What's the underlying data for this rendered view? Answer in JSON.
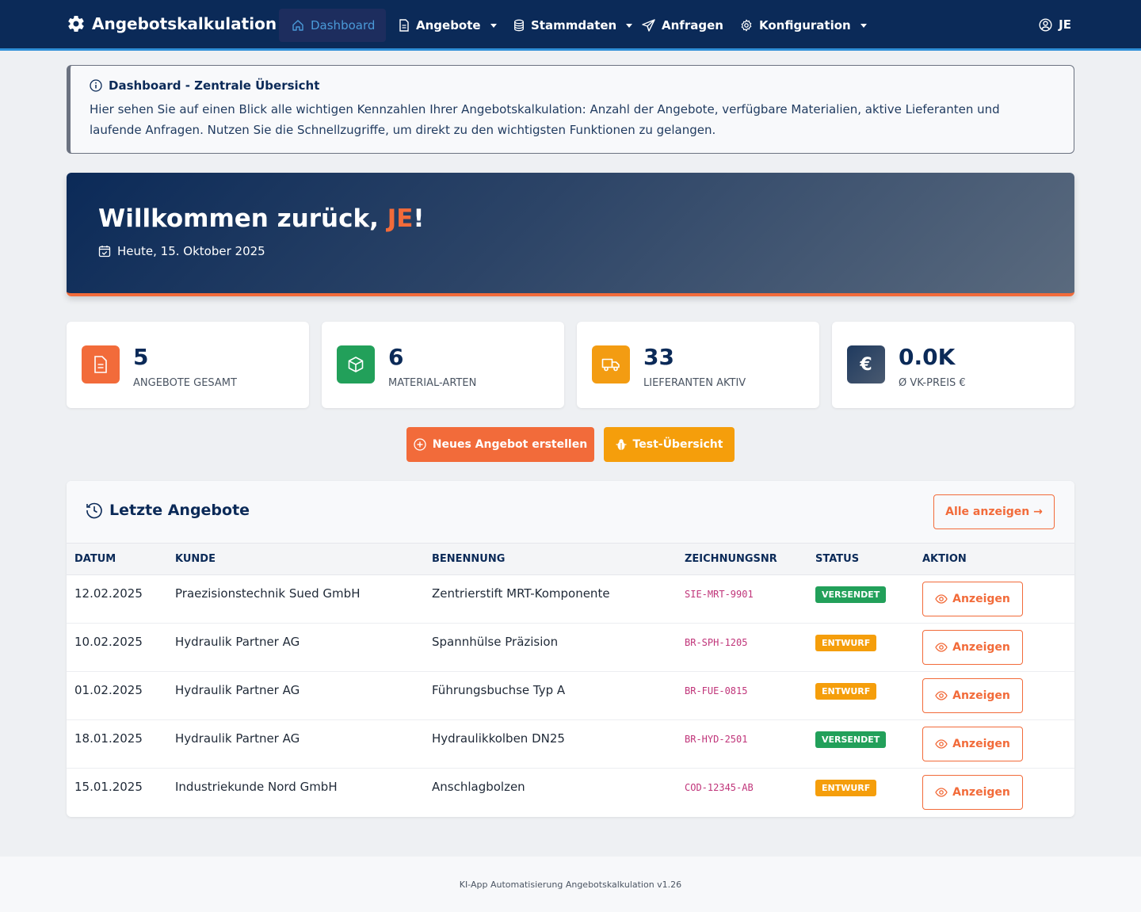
{
  "navbar": {
    "brand": "Angebotskalkulation",
    "items": [
      {
        "label": "Dashboard"
      },
      {
        "label": "Angebote"
      },
      {
        "label": "Stammdaten"
      },
      {
        "label": "Anfragen"
      },
      {
        "label": "Konfiguration"
      }
    ],
    "user": "JE"
  },
  "info": {
    "title": "Dashboard - Zentrale Übersicht",
    "text": "Hier sehen Sie auf einen Blick alle wichtigen Kennzahlen Ihrer Angebotskalkulation: Anzahl der Angebote, verfügbare Materialien, aktive Lieferanten und laufende Anfragen. Nutzen Sie die Schnellzugriffe, um direkt zu den wichtigsten Funktionen zu gelangen."
  },
  "welcome": {
    "greeting": "Willkommen zurück, ",
    "name": "JE",
    "exclaim": "!",
    "date": "Heute, 15. Oktober 2025"
  },
  "stats": [
    {
      "value": "5",
      "label": "Angebote gesamt",
      "icon": "document-icon",
      "color": "#f26b3a"
    },
    {
      "value": "6",
      "label": "Material-Arten",
      "icon": "box-icon",
      "color": "#22a05a"
    },
    {
      "value": "33",
      "label": "Lieferanten aktiv",
      "icon": "truck-icon",
      "color": "#f39c12"
    },
    {
      "value": "0.0K",
      "label": "Ø VK-Preis €",
      "icon": "euro-icon",
      "color": "#1f3a5f",
      "symbol": "€"
    }
  ],
  "actions": {
    "new_offer": "Neues Angebot erstellen",
    "test_overview": "Test-Übersicht"
  },
  "recent": {
    "title": "Letzte Angebote",
    "show_all": "Alle anzeigen →",
    "columns": [
      "Datum",
      "Kunde",
      "Benennung",
      "Zeichnungsnr",
      "Status",
      "Aktion"
    ],
    "view_label": "Anzeigen",
    "rows": [
      {
        "date": "12.02.2025",
        "customer": "Praezisionstechnik Sued GmbH",
        "name": "Zentrierstift MRT-Komponente",
        "drawing": "SIE-MRT-9901",
        "status": "VERSENDET",
        "status_color": "green"
      },
      {
        "date": "10.02.2025",
        "customer": "Hydraulik Partner AG",
        "name": "Spannhülse Präzision",
        "drawing": "BR-SPH-1205",
        "status": "ENTWURF",
        "status_color": "orange"
      },
      {
        "date": "01.02.2025",
        "customer": "Hydraulik Partner AG",
        "name": "Führungsbuchse Typ A",
        "drawing": "BR-FUE-0815",
        "status": "ENTWURF",
        "status_color": "orange"
      },
      {
        "date": "18.01.2025",
        "customer": "Hydraulik Partner AG",
        "name": "Hydraulikkolben DN25",
        "drawing": "BR-HYD-2501",
        "status": "VERSENDET",
        "status_color": "green"
      },
      {
        "date": "15.01.2025",
        "customer": "Industriekunde Nord GmbH",
        "name": "Anschlagbolzen",
        "drawing": "COD-12345-AB",
        "status": "ENTWURF",
        "status_color": "orange"
      }
    ]
  },
  "footer": "KI-App Automatisierung Angebotskalkulation v1.26"
}
